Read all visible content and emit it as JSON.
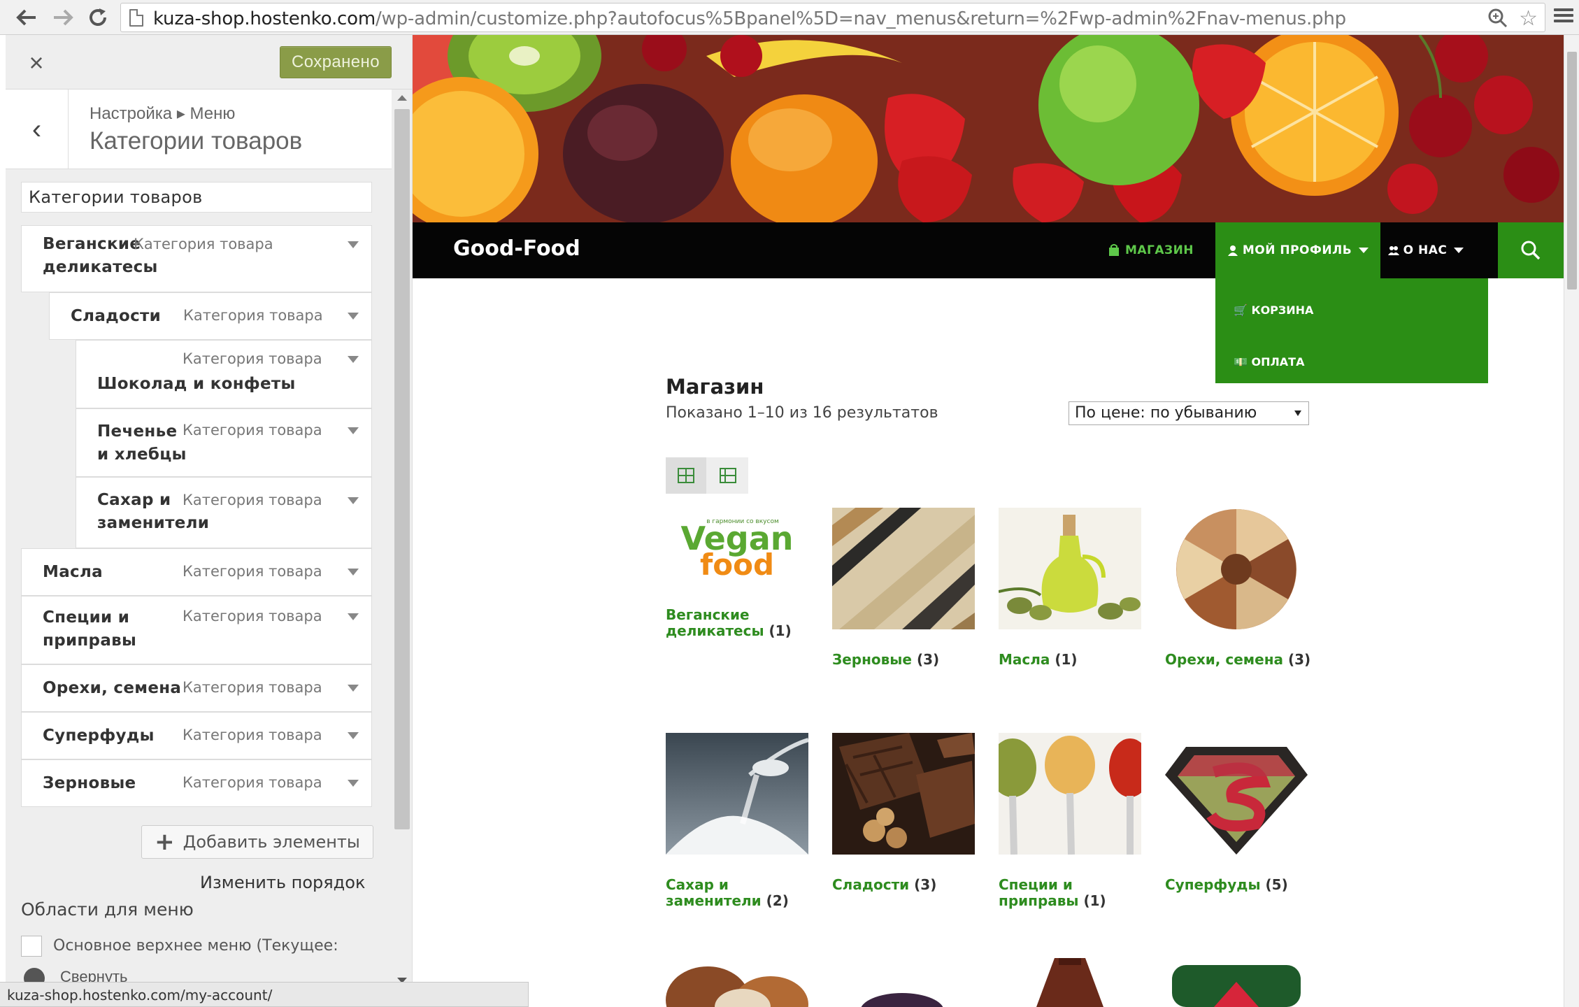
{
  "browser": {
    "url_host": "kuza-shop.hostenko.com",
    "url_path": "/wp-admin/customize.php?autofocus%5Bpanel%5D=nav_menus&return=%2Fwp-admin%2Fnav-menus.php",
    "status_url": "kuza-shop.hostenko.com/my-account/"
  },
  "panel": {
    "close_icon": "×",
    "save_label": "Сохранено",
    "back_icon": "‹",
    "breadcrumb": "Настройка ▸ Меню",
    "section_title": "Категории товаров",
    "menu_name": "Категории товаров",
    "items": [
      {
        "title": "Веганские деликатесы",
        "type": "Категория товара"
      },
      {
        "title": "Сладости",
        "type": "Категория товара"
      },
      {
        "title": "Шоколад и конфеты",
        "type": "Категория товара"
      },
      {
        "title": "Печенье и хлебцы",
        "type": "Категория товара"
      },
      {
        "title": "Сахар и заменители",
        "type": "Категория товара"
      },
      {
        "title": "Масла",
        "type": "Категория товара"
      },
      {
        "title": "Специи и приправы",
        "type": "Категория товара"
      },
      {
        "title": "Орехи, семена",
        "type": "Категория товара"
      },
      {
        "title": "Суперфуды",
        "type": "Категория товара"
      },
      {
        "title": "Зерновые",
        "type": "Категория товара"
      }
    ],
    "add_items_label": "Добавить элементы",
    "reorder_label": "Изменить порядок",
    "locations_title": "Области для меню",
    "location_label": "Основное верхнее меню (Текущее:",
    "collapse_label": "Свернуть"
  },
  "site": {
    "title": "Good-Food",
    "nav": {
      "shop": "МАГАЗИН",
      "profile": "МОЙ ПРОФИЛЬ",
      "about": "О НАС"
    },
    "dropdown": {
      "cart": "КОРЗИНА",
      "payment": "ОПЛАТА"
    },
    "shop_title": "Магазин",
    "result_count": "Показано 1–10 из 16 результатов",
    "orderby": "По цене: по убыванию",
    "vegan_logo_small": "в гармонии со вкусом",
    "vegan_logo_top": "Vegan",
    "vegan_logo_bottom": "food",
    "categories": [
      {
        "name": "Веганские деликатесы",
        "count": "(1)"
      },
      {
        "name": "Зерновые",
        "count": "(3)"
      },
      {
        "name": "Масла",
        "count": "(1)"
      },
      {
        "name": "Орехи, семена",
        "count": "(3)"
      },
      {
        "name": "Сахар и заменители",
        "count": "(2)"
      },
      {
        "name": "Сладости",
        "count": "(3)"
      },
      {
        "name": "Специи и приправы",
        "count": "(1)"
      },
      {
        "name": "Суперфуды",
        "count": "(5)"
      }
    ]
  },
  "colors": {
    "accent_green": "#2b8e15",
    "link_green": "#2e8c1f",
    "save_button": "#8a9c48"
  }
}
